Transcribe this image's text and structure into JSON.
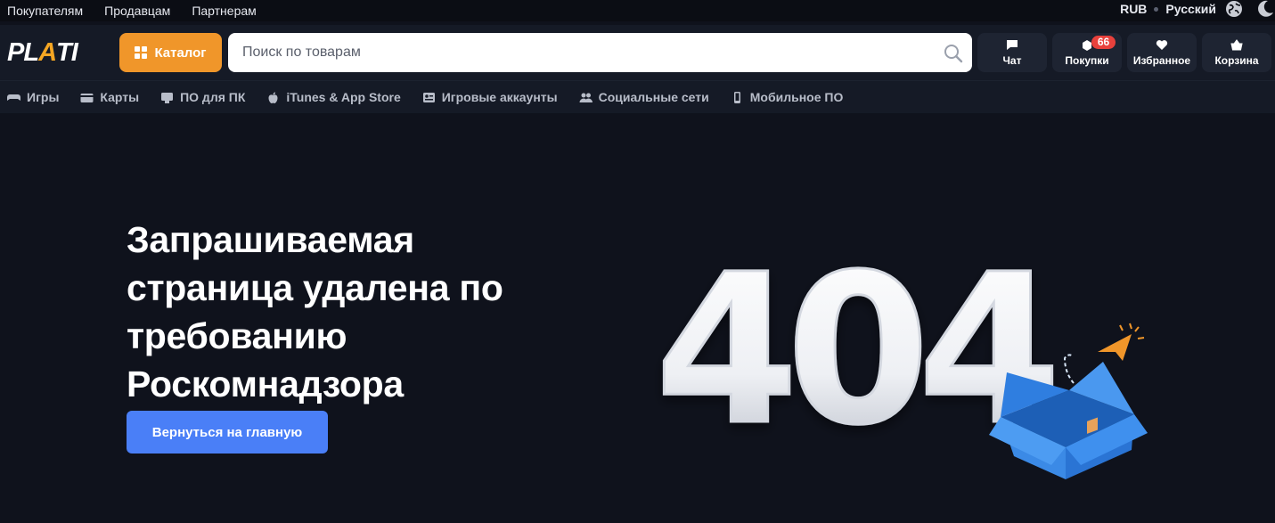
{
  "topbar": {
    "links": [
      "Покупателям",
      "Продавцам",
      "Партнерам"
    ],
    "currency": "RUB",
    "language": "Русский",
    "icons": [
      "globe-icon",
      "moon-icon"
    ]
  },
  "header": {
    "logo": {
      "part1": "PL",
      "accent": "A",
      "part2": "TI"
    },
    "catalog_label": "Каталог",
    "search_placeholder": "Поиск по товарам",
    "buttons": {
      "chat": "Чат",
      "purchases": "Покупки",
      "purchases_badge": "66",
      "favorites": "Избранное",
      "cart": "Корзина"
    }
  },
  "categories": [
    {
      "label": "Игры",
      "icon": "gamepad-icon"
    },
    {
      "label": "Карты",
      "icon": "card-icon"
    },
    {
      "label": "ПО для ПК",
      "icon": "software-icon"
    },
    {
      "label": "iTunes & App Store",
      "icon": "apple-icon"
    },
    {
      "label": "Игровые аккаунты",
      "icon": "account-icon"
    },
    {
      "label": "Социальные сети",
      "icon": "people-icon"
    },
    {
      "label": "Мобильное ПО",
      "icon": "mobile-icon"
    }
  ],
  "hero": {
    "title_lines": [
      "Запрашиваемая",
      "страница удалена по",
      "требованию",
      "Роскомнадзора"
    ],
    "button_label": "Вернуться на главную",
    "illustration_text": "404"
  },
  "colors": {
    "background": "#0f121c",
    "header": "#151a26",
    "accent_orange": "#f0962a",
    "primary_blue": "#4a7ff7",
    "badge_red": "#e8413c",
    "box_blue": "#2f7ee0"
  }
}
